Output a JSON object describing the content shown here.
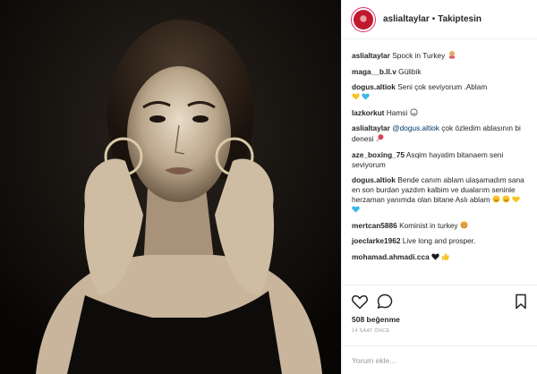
{
  "header": {
    "username": "aslialtaylar",
    "separator": "•",
    "follow_state": "Takiptesin"
  },
  "comments": [
    {
      "user": "aslialtaylar",
      "text": "Spock in Turkey"
    },
    {
      "user": "maga__b.ll.v",
      "text": "Gülibik"
    },
    {
      "user": "dogus.altiok",
      "text": "Seni çok seviyorum .Ablam"
    },
    {
      "user": "lazkorkut",
      "text": "Hamsi"
    },
    {
      "user": "aslialtaylar",
      "mention": "@dogus.altiok",
      "text": "çok özledim ablasının bi denesi"
    },
    {
      "user": "aze_boxing_75",
      "text": "Asqim hayatim bitanaem seni seviyorum"
    },
    {
      "user": "dogus.altiok",
      "text": "Bende canım ablam ulaşamadım sana en son burdan yazdım kalbim ve dualarım seninle herzaman yanımda olan bitane Aslı ablam"
    },
    {
      "user": "mertcan5886",
      "text": "Kominist in turkey"
    },
    {
      "user": "joeclarke1962",
      "text": "Live long and prosper."
    },
    {
      "user": "mohamad.ahmadi.cca",
      "text": ""
    }
  ],
  "icons": {
    "like": "heart-outline-icon",
    "comment": "speech-bubble-icon",
    "save": "bookmark-icon",
    "colors": {
      "yellow_heart": "#f7c325",
      "blue_heart": "#3bb7e6",
      "black_heart": "#1a1a1a",
      "red_accent": "#c0182c"
    }
  },
  "stats": {
    "likes": "508 beğenme",
    "time": "14 SAAT ÖNCE"
  },
  "add_comment": {
    "placeholder": "Yorum ekle..."
  }
}
